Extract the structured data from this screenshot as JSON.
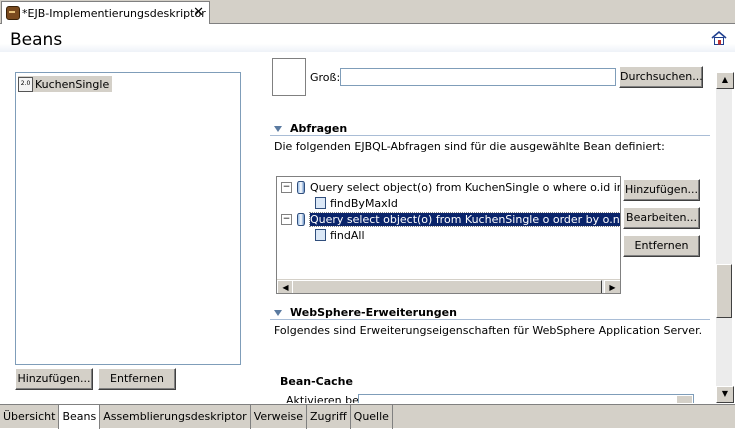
{
  "tab": {
    "title": "*EJB-Implementierungsdeskriptor",
    "close": "✕"
  },
  "page": {
    "title": "Beans"
  },
  "icons": {
    "home": "home-icon",
    "tab": "ejb-descriptor-icon",
    "bean": "ejb-bean-icon",
    "query": "query-db-icon",
    "method": "method-icon"
  },
  "beans": {
    "items": [
      {
        "label": "KuchenSingle",
        "icon_text": "2.0"
      }
    ],
    "add_label": "Hinzufügen...",
    "remove_label": "Entfernen"
  },
  "image_field": {
    "size_label": "Groß:",
    "value": "",
    "browse_label": "Durchsuchen..."
  },
  "queries_section": {
    "title": "Abfragen",
    "description": "Die folgenden EJBQL-Abfragen sind für die ausgewählte Bean definiert:",
    "queries": [
      {
        "expander": "−",
        "text": "Query select object(o) from KuchenSingle o where  o.id in (sele",
        "method": "findByMaxId",
        "selected": false
      },
      {
        "expander": "−",
        "text": "Query select object(o) from KuchenSingle o order by o.name",
        "method": "findAll",
        "selected": true
      }
    ],
    "add_label": "Hinzufügen...",
    "edit_label": "Bearbeiten...",
    "remove_label": "Entfernen"
  },
  "websphere_section": {
    "title": "WebSphere-Erweiterungen",
    "description": "Folgendes sind Erweiterungseigenschaften für WebSphere Application Server."
  },
  "bean_cache": {
    "title": "Bean-Cache",
    "activate_label": "Aktivieren bei:",
    "activate_value": ""
  },
  "page_tabs": [
    {
      "label": "Übersicht",
      "active": false
    },
    {
      "label": "Beans",
      "active": true
    },
    {
      "label": "Assemblierungsdeskriptor",
      "active": false
    },
    {
      "label": "Verweise",
      "active": false
    },
    {
      "label": "Zugriff",
      "active": false
    },
    {
      "label": "Quelle",
      "active": false
    }
  ],
  "colors": {
    "selection": "#0a246a",
    "section_twisty": "#5a7aa0",
    "separator": "#a9bdd6"
  }
}
